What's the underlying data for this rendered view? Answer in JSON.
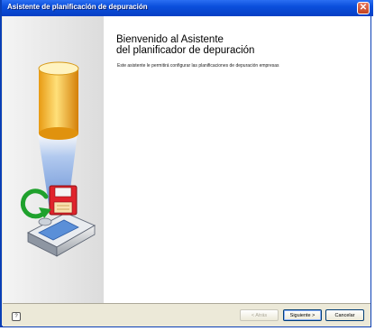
{
  "window": {
    "title": "Asistente de planificación de depuración"
  },
  "main": {
    "heading_line1": "Bienvenido al Asistente",
    "heading_line2": "del planificador de depuración",
    "description": "Este asistente le permitirá configurar las planificaciones de depuración empresas"
  },
  "footer": {
    "help": "?",
    "back_label": "< Atrás",
    "next_label": "Siguiente >",
    "cancel_label": "Cancelar"
  },
  "icons": [
    "close-icon",
    "database-cylinder-icon",
    "backup-drive-icon",
    "refresh-arrow-icon",
    "floppy-disk-icon",
    "help-icon"
  ],
  "colors": {
    "titlebar": "#0b4fdc",
    "cylinder": "#f0b020",
    "beam": "#7fa8e6",
    "floppy": "#e0232b",
    "arrow": "#1fa12d"
  }
}
